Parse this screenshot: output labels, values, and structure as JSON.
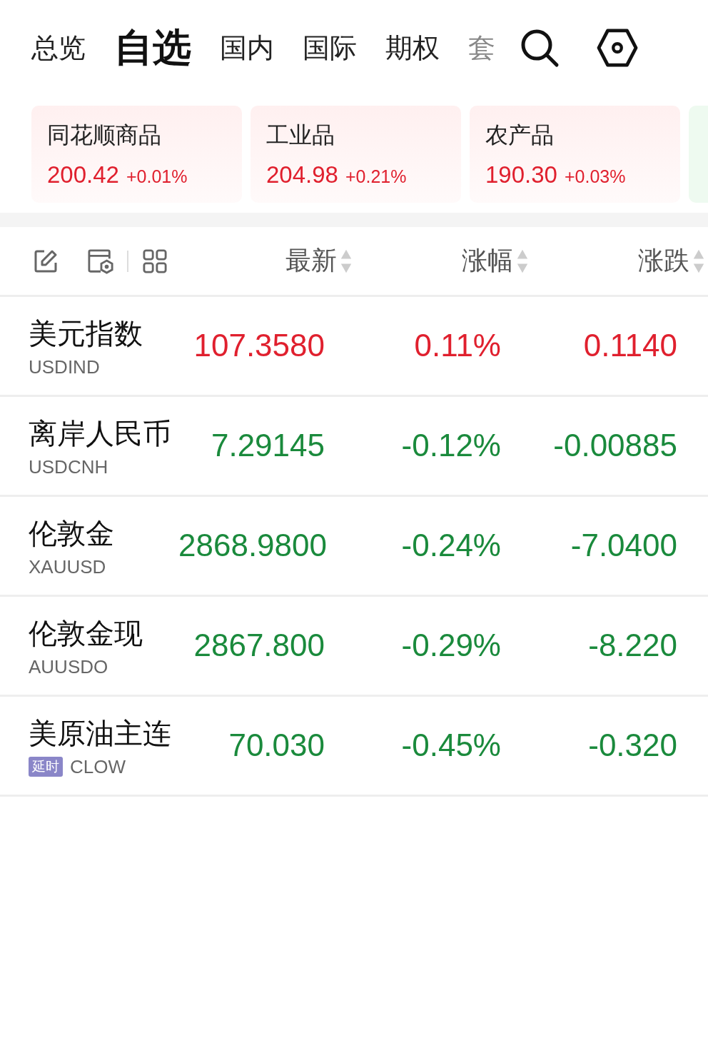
{
  "tabs": [
    {
      "label": "总览",
      "selected": false
    },
    {
      "label": "自选",
      "selected": true
    },
    {
      "label": "国内",
      "selected": false
    },
    {
      "label": "国际",
      "selected": false
    },
    {
      "label": "期权",
      "selected": false
    },
    {
      "label": "套",
      "selected": false
    }
  ],
  "cards": [
    {
      "name": "同花顺商品",
      "value": "200.42",
      "change": "+0.01%",
      "kind": "up"
    },
    {
      "name": "工业品",
      "value": "204.98",
      "change": "+0.21%",
      "kind": "up"
    },
    {
      "name": "农产品",
      "value": "190.30",
      "change": "+0.03%",
      "kind": "up"
    }
  ],
  "table": {
    "columns": [
      "最新",
      "涨幅",
      "涨跌"
    ],
    "rows": [
      {
        "name": "美元指数",
        "code": "USDIND",
        "price": "107.3580",
        "pct": "0.11%",
        "change": "0.1140",
        "kind": "up"
      },
      {
        "name": "离岸人民币",
        "code": "USDCNH",
        "price": "7.29145",
        "pct": "-0.12%",
        "change": "-0.00885",
        "kind": "down"
      },
      {
        "name": "伦敦金",
        "code": "XAUUSD",
        "price": "2868.9800",
        "pct": "-0.24%",
        "change": "-7.0400",
        "kind": "down"
      },
      {
        "name": "伦敦金现",
        "code": "AUUSDO",
        "price": "2867.800",
        "pct": "-0.29%",
        "change": "-8.220",
        "kind": "down"
      },
      {
        "name": "美原油主连",
        "badge": "延时",
        "code": "CLOW",
        "price": "70.030",
        "pct": "-0.45%",
        "change": "-0.320",
        "kind": "down"
      }
    ]
  }
}
